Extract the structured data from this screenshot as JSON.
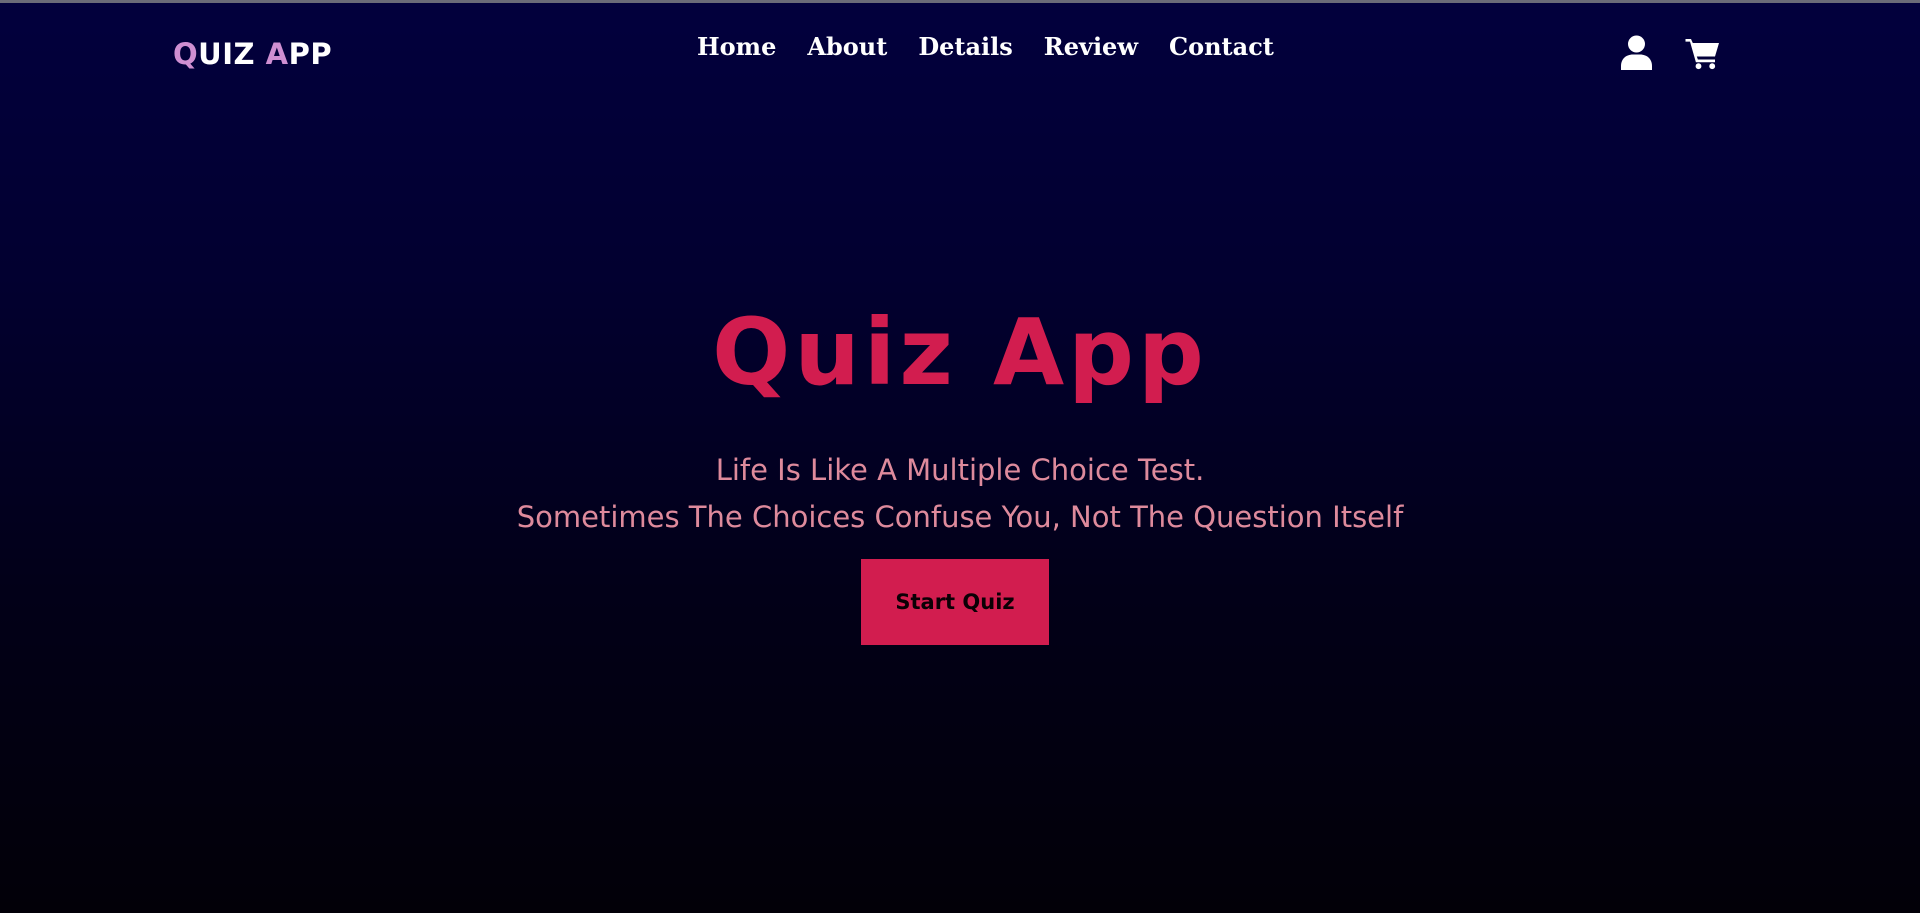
{
  "header": {
    "logo": {
      "first_initial": "Q",
      "first_rest": "UIZ ",
      "second_initial": "A",
      "second_rest": "PP"
    },
    "nav": [
      {
        "label": "Home"
      },
      {
        "label": "About"
      },
      {
        "label": "Details"
      },
      {
        "label": "Review"
      },
      {
        "label": "Contact"
      }
    ],
    "icons": [
      "user-icon",
      "cart-icon"
    ]
  },
  "hero": {
    "title": "Quiz App",
    "tagline_line1": "Life Is Like A Multiple Choice Test.",
    "tagline_line2": "Sometimes The Choices Confuse You, Not The Question Itself",
    "cta_label": "Start Quiz"
  },
  "colors": {
    "background_top": "#02003d",
    "background_bottom": "#020008",
    "accent": "#d21d4f",
    "tagline": "#de8a9c",
    "logo_accent": "#cf8fd2",
    "nav_text": "#ffffff"
  }
}
